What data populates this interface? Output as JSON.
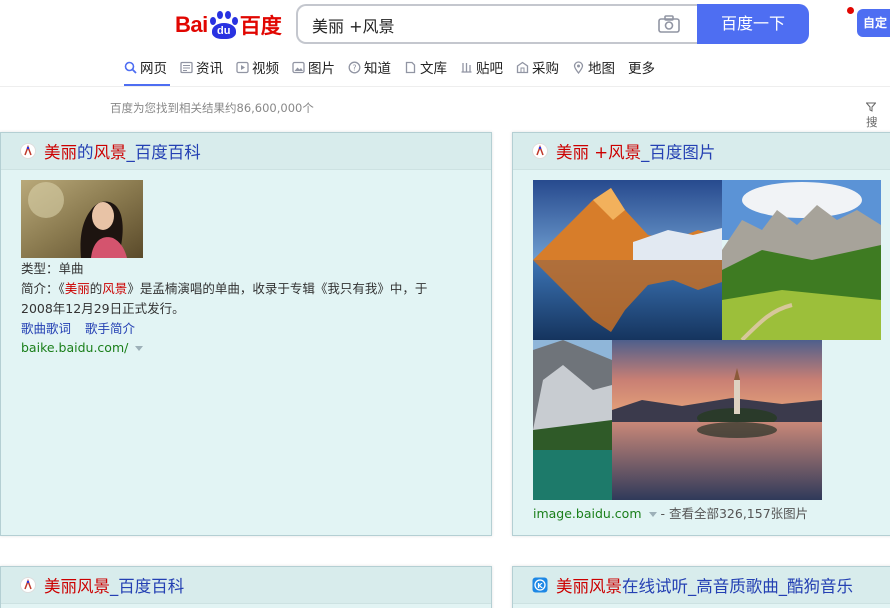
{
  "logo": {
    "left": "Bai",
    "paw_text": "du",
    "right": "百度"
  },
  "search": {
    "query": "美丽 +风景",
    "button_label": "百度一下"
  },
  "custom_button": "自定",
  "tabs": [
    {
      "label": "网页",
      "icon": "search-icon",
      "active": true
    },
    {
      "label": "资讯",
      "icon": "news-icon"
    },
    {
      "label": "视频",
      "icon": "video-icon"
    },
    {
      "label": "图片",
      "icon": "image-icon"
    },
    {
      "label": "知道",
      "icon": "question-icon"
    },
    {
      "label": "文库",
      "icon": "document-icon"
    },
    {
      "label": "贴吧",
      "icon": "tieba-icon"
    },
    {
      "label": "采购",
      "icon": "shop-icon"
    },
    {
      "label": "地图",
      "icon": "map-pin-icon"
    },
    {
      "label": "更多"
    }
  ],
  "result_count": "百度为您找到相关结果约86,600,000个",
  "tools_label": "搜",
  "cards": {
    "baike": {
      "title_hl1": "美丽",
      "title_mid": "的",
      "title_hl2": "风景",
      "title_rest": "_百度百科",
      "type_line": "类型：单曲",
      "intro_prefix": "简介：《",
      "intro_hl1": "美丽",
      "intro_mid": "的",
      "intro_hl2": "风景",
      "intro_rest": "》是孟楠演唱的单曲，收录于专辑《我只有我》中，于",
      "intro_line2": "2008年12月29日正式发行。",
      "link1": "歌曲歌词",
      "link2": "歌手简介",
      "url": "baike.baidu.com/"
    },
    "images": {
      "title_hl1": "美丽",
      "title_hl2": " +风景",
      "title_rest": "_百度图片",
      "url": "image.baidu.com",
      "view_all": " - 查看全部326,157张图片"
    },
    "baike2": {
      "title_hl": "美丽风景",
      "title_rest": "_百度百科"
    },
    "kugou": {
      "title_hl": "美丽风景",
      "title_rest": "在线试听_高音质歌曲_酷狗音乐"
    }
  },
  "colors": {
    "accent": "#4e6ef2",
    "brand_red": "#e10601",
    "link_blue": "#2440b3",
    "highlight_red": "#cc0000",
    "card_bg": "#e2f4f4"
  }
}
